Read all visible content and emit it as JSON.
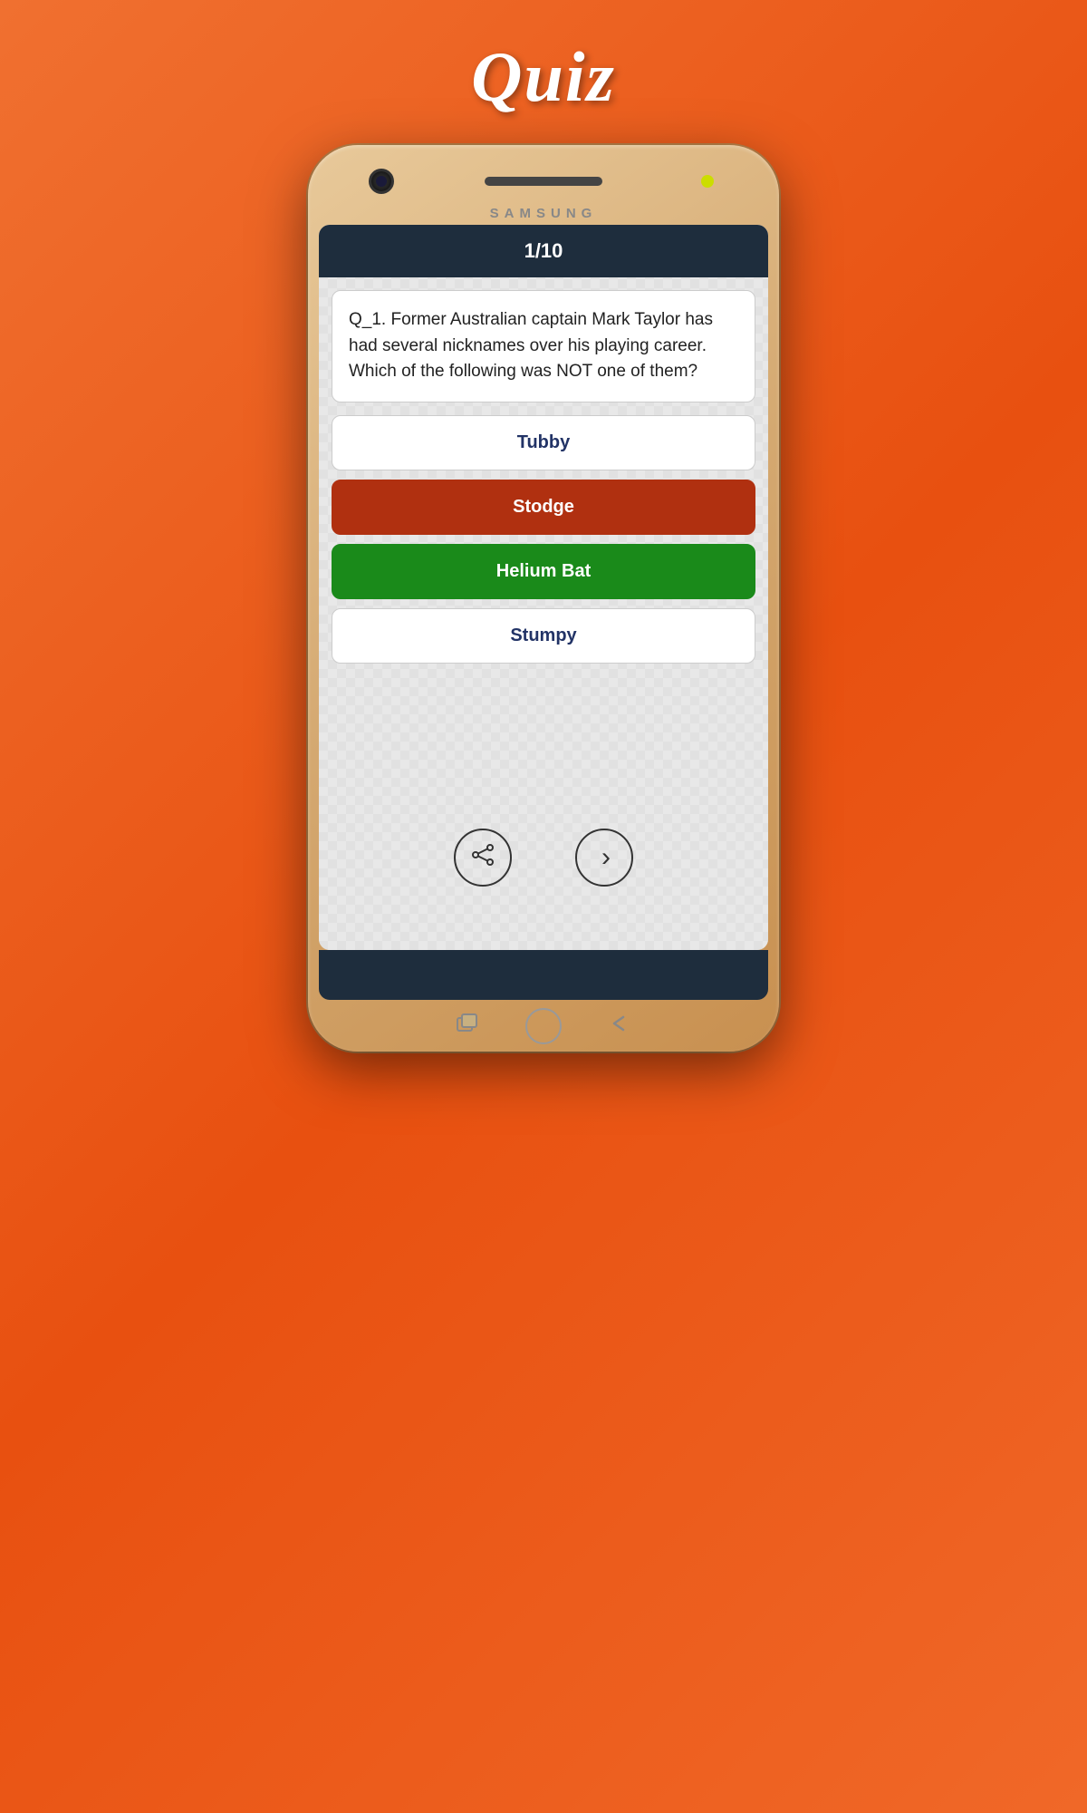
{
  "app": {
    "title": "Quiz",
    "brand": "SAMSUNG"
  },
  "header": {
    "progress": "1/10"
  },
  "question": {
    "number": "Q_1.",
    "text": "Q_1.  Former Australian captain Mark Taylor has had several nicknames over his playing career. Which of the following was NOT one of them?"
  },
  "answers": [
    {
      "id": "a1",
      "label": "Tubby",
      "state": "default"
    },
    {
      "id": "a2",
      "label": "Stodge",
      "state": "wrong"
    },
    {
      "id": "a3",
      "label": "Helium Bat",
      "state": "correct"
    },
    {
      "id": "a4",
      "label": "Stumpy",
      "state": "default"
    }
  ],
  "nav_buttons": {
    "share_icon": "⟨",
    "next_icon": "›"
  },
  "phone": {
    "samsung_label": "SAMSUNG"
  },
  "colors": {
    "background_orange": "#f06020",
    "phone_gold": "#d4a870",
    "header_dark": "#1e2d3d",
    "wrong_red": "#b03010",
    "correct_green": "#1a8a1a",
    "default_text": "#223366"
  }
}
